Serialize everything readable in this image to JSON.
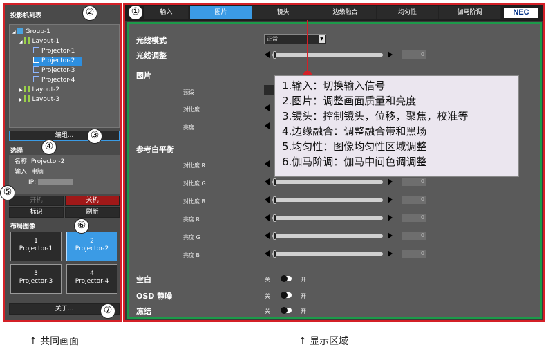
{
  "left": {
    "list_title": "投影机列表",
    "tree": [
      {
        "label": "Group-1",
        "icon": "folder-icon"
      },
      {
        "label": "Layout-1",
        "icon": "grid-icon"
      },
      {
        "label": "Projector-1",
        "icon": "projector-icon"
      },
      {
        "label": "Projector-2",
        "icon": "projector-icon"
      },
      {
        "label": "Projector-3",
        "icon": "projector-icon"
      },
      {
        "label": "Projector-4",
        "icon": "projector-icon"
      },
      {
        "label": "Layout-2",
        "icon": "grid-icon"
      },
      {
        "label": "Layout-3",
        "icon": "grid-icon"
      }
    ],
    "edit_button": "编组...",
    "select_label": "选择",
    "info": {
      "name_label": "名称:",
      "name_value": "Projector-2",
      "input_label": "输入:",
      "input_value": "电脑",
      "ip_label": "IP:"
    },
    "power_on": "开机",
    "power_off": "关机",
    "identify": "标识",
    "refresh": "刷新",
    "layout_image_label": "布局图像",
    "projectors": [
      {
        "num": "1",
        "name": "Projector-1"
      },
      {
        "num": "2",
        "name": "Projector-2"
      },
      {
        "num": "3",
        "name": "Projector-3"
      },
      {
        "num": "4",
        "name": "Projector-4"
      }
    ],
    "about_button": "关于..."
  },
  "tabs": [
    "输入",
    "图片",
    "镜头",
    "边缘融合",
    "均匀性",
    "伽马阶调"
  ],
  "active_tab": 1,
  "brand": "NEC",
  "main": {
    "light_mode_label": "光线模式",
    "light_mode_value": "正常",
    "light_adjust_label": "光线调整",
    "light_adjust_value": "0",
    "picture_label": "图片",
    "preset_label": "预设",
    "contrast_label": "对比度",
    "brightness_label": "亮度",
    "wb_label": "参考白平衡",
    "wb_rows": [
      {
        "label": "对比度 R",
        "value": "0"
      },
      {
        "label": "对比度 G",
        "value": "0"
      },
      {
        "label": "对比度 B",
        "value": "0"
      },
      {
        "label": "亮度 R",
        "value": "0"
      },
      {
        "label": "亮度 G",
        "value": "0"
      },
      {
        "label": "亮度 B",
        "value": "0"
      }
    ],
    "blank_label": "空白",
    "osd_label": "OSD 静噪",
    "freeze_label": "冻结",
    "off_label": "关",
    "on_label": "开"
  },
  "info_lines": [
    "1.输入：切换输入信号",
    "2.图片：调整画面质量和亮度",
    "3.镜头：控制镜头，位移，聚焦，校准等",
    "4.边缘融合：调整融合带和黑场",
    "5.均匀性：图像均匀性区域调整",
    "6.伽马阶调：伽马中间色调调整"
  ],
  "callouts": [
    "①",
    "②",
    "③",
    "④",
    "⑤",
    "⑥",
    "⑦"
  ],
  "captions": {
    "left": "↑ 共同画面",
    "right": "↑ 显示区域"
  },
  "colors": {
    "frame_red": "#d42027",
    "frame_green": "#1c9a4a",
    "accent_blue": "#3b9be5",
    "power_off_red": "#a01818"
  }
}
